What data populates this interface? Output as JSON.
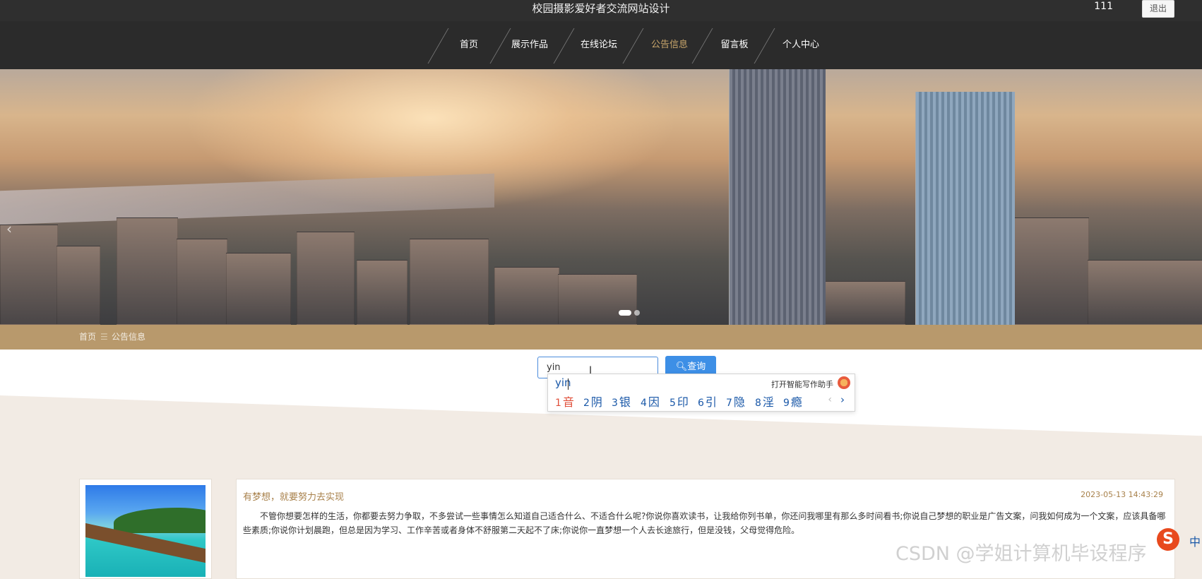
{
  "header": {
    "site_title": "校园摄影爱好者交流网站设计",
    "user": "111",
    "logout_label": "退出"
  },
  "nav": {
    "items": [
      "首页",
      "展示作品",
      "在线论坛",
      "公告信息",
      "留言板",
      "个人中心"
    ],
    "active_index": 3,
    "active_color": "#c9a66b"
  },
  "banner": {
    "prev_icon": "chevron-left-icon",
    "slide_count": 2,
    "active_slide": 0
  },
  "breadcrumb": {
    "home": "首页",
    "separator": "☰",
    "current": "公告信息"
  },
  "search": {
    "value": "yin",
    "button_label": "查询",
    "button_icon": "search-icon"
  },
  "ime": {
    "composition": "yin",
    "assistant_label": "打开智能写作助手",
    "candidates": [
      {
        "num": "1",
        "text": "音"
      },
      {
        "num": "2",
        "text": "阴"
      },
      {
        "num": "3",
        "text": "银"
      },
      {
        "num": "4",
        "text": "因"
      },
      {
        "num": "5",
        "text": "印"
      },
      {
        "num": "6",
        "text": "引"
      },
      {
        "num": "7",
        "text": "隐"
      },
      {
        "num": "8",
        "text": "淫"
      },
      {
        "num": "9",
        "text": "瘾"
      }
    ],
    "prev": "‹",
    "next": "›"
  },
  "notice": {
    "title": "有梦想，就要努力去实现",
    "date": "2023-05-13 14:43:29",
    "body": "不管你想要怎样的生活，你都要去努力争取，不多尝试一些事情怎么知道自己适合什么、不适合什么呢?你说你喜欢读书，让我给你列书单，你还问我哪里有那么多时间看书;你说自己梦想的职业是广告文案，问我如何成为一个文案，应该具备哪些素质;你说你计划晨跑，但总是因为学习、工作辛苦或者身体不舒服第二天起不了床;你说你一直梦想一个人去长途旅行，但是没钱，父母觉得危险。"
  },
  "overlay": {
    "watermark": "CSDN @学姐计算机毕设程序",
    "ime_status": "中",
    "ime_logo": "S"
  }
}
